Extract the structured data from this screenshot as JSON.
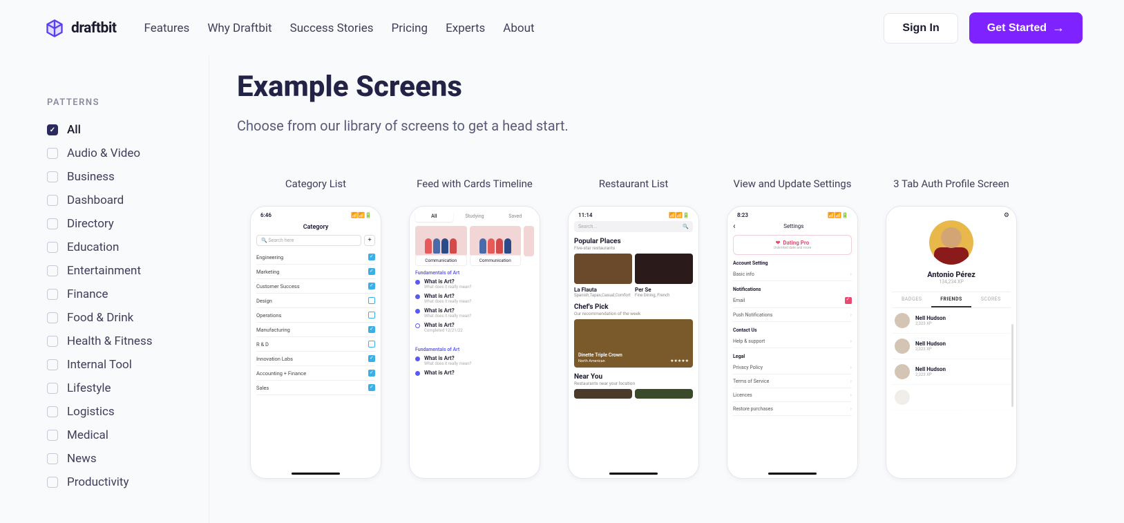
{
  "brand": "draftbit",
  "nav": {
    "features": "Features",
    "why": "Why Draftbit",
    "success": "Success Stories",
    "pricing": "Pricing",
    "experts": "Experts",
    "about": "About"
  },
  "header": {
    "signin": "Sign In",
    "getstarted": "Get Started"
  },
  "sidebar": {
    "heading": "PATTERNS",
    "items": [
      {
        "label": "All",
        "checked": true
      },
      {
        "label": "Audio & Video",
        "checked": false
      },
      {
        "label": "Business",
        "checked": false
      },
      {
        "label": "Dashboard",
        "checked": false
      },
      {
        "label": "Directory",
        "checked": false
      },
      {
        "label": "Education",
        "checked": false
      },
      {
        "label": "Entertainment",
        "checked": false
      },
      {
        "label": "Finance",
        "checked": false
      },
      {
        "label": "Food & Drink",
        "checked": false
      },
      {
        "label": "Health & Fitness",
        "checked": false
      },
      {
        "label": "Internal Tool",
        "checked": false
      },
      {
        "label": "Lifestyle",
        "checked": false
      },
      {
        "label": "Logistics",
        "checked": false
      },
      {
        "label": "Medical",
        "checked": false
      },
      {
        "label": "News",
        "checked": false
      },
      {
        "label": "Productivity",
        "checked": false
      }
    ]
  },
  "page": {
    "title": "Example Screens",
    "subtitle": "Choose from our library of screens to get a head start."
  },
  "cards": [
    {
      "title": "Category List"
    },
    {
      "title": "Feed with Cards Timeline"
    },
    {
      "title": "Restaurant List"
    },
    {
      "title": "View and Update Settings"
    },
    {
      "title": "3 Tab Auth Profile Screen"
    }
  ],
  "phone1": {
    "time": "6:46",
    "heading": "Category",
    "search_placeholder": "Search here",
    "rows": [
      {
        "label": "Engineering",
        "on": true
      },
      {
        "label": "Marketing",
        "on": true
      },
      {
        "label": "Customer Success",
        "on": true
      },
      {
        "label": "Design",
        "on": false
      },
      {
        "label": "Operations",
        "on": false
      },
      {
        "label": "Manufacturing",
        "on": true
      },
      {
        "label": "R & D",
        "on": false
      },
      {
        "label": "Innovation Labs",
        "on": true
      },
      {
        "label": "Accounting + Finance",
        "on": true
      },
      {
        "label": "Sales",
        "on": true
      }
    ]
  },
  "phone2": {
    "tabs": {
      "all": "All",
      "studying": "Studying",
      "saved": "Saved"
    },
    "chip": "Communication",
    "section": "Fundamentals of Art",
    "item_title": "What is Art?",
    "item_sub": "What does it really mean?",
    "completed": "Completed 12/21/22"
  },
  "phone3": {
    "time": "11:14",
    "search": "Search...",
    "h1": "Popular Places",
    "s1": "Five-star restaurants",
    "r1": "La Flauta",
    "t1": "Spanish,Tapas,Casual,Comfort",
    "r2": "Per Se",
    "t2": "Fine Dining, French",
    "h2": "Chef's Pick",
    "s2": "Our recommendation of the week",
    "overlay": "Dinette Triple Crown",
    "overlay_sub": "North American",
    "h3": "Near You",
    "s3": "Restaurants near your location"
  },
  "phone4": {
    "time": "8:23",
    "heading": "Settings",
    "brand": "Dating Pro",
    "brand_sub": "Unlimited date and more",
    "g1": "Account Setting",
    "r1": "Basic info",
    "g2": "Notifications",
    "r2": "Email",
    "r3": "Push Notifications",
    "g3": "Contact Us",
    "r4": "Help & support",
    "g4": "Legal",
    "r5": "Privacy Policy",
    "r6": "Terms of Service",
    "r7": "Licences",
    "r8": "Restore purchases"
  },
  "phone5": {
    "name": "Antonio Pérez",
    "xp": "134,234 XP",
    "tabs": {
      "badges": "BADGES",
      "friends": "FRIENDS",
      "scores": "SCORES"
    },
    "friend_name": "Nell Hudson",
    "friend_xp": "2,323 XP"
  }
}
